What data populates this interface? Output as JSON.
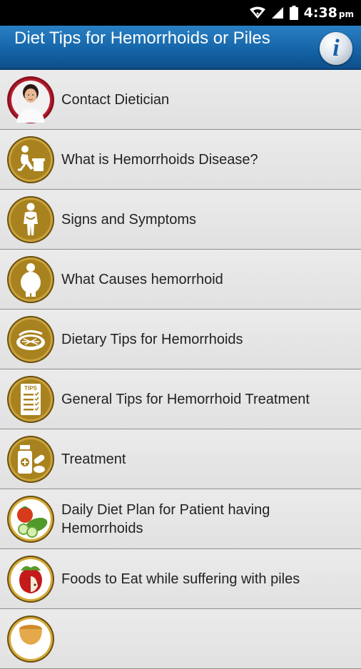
{
  "status_bar": {
    "time": "4:38",
    "ampm": "pm"
  },
  "app_bar": {
    "title": "Diet Tips for Hemorrhoids or Piles"
  },
  "menu": {
    "items": [
      {
        "label": "Contact Dietician",
        "icon": "dietician-avatar-icon"
      },
      {
        "label": "What is Hemorrhoids Disease?",
        "icon": "person-sitting-icon"
      },
      {
        "label": "Signs and Symptoms",
        "icon": "person-symptom-icon"
      },
      {
        "label": "What Causes hemorrhoid",
        "icon": "overweight-person-icon"
      },
      {
        "label": "Dietary Tips for Hemorrhoids",
        "icon": "food-plate-icon"
      },
      {
        "label": "General Tips for Hemorrhoid Treatment",
        "icon": "tips-checklist-icon"
      },
      {
        "label": "Treatment",
        "icon": "medicine-bottle-icon"
      },
      {
        "label": "Daily Diet Plan for Patient having Hemorrhoids",
        "icon": "vegetables-icon"
      },
      {
        "label": "Foods to Eat while suffering with piles",
        "icon": "apple-icon"
      },
      {
        "label": "",
        "icon": "tea-cup-icon"
      }
    ]
  },
  "icons": {
    "tips_text": "TIPS"
  },
  "colors": {
    "app_bar": "#1565a8",
    "gold": "#b8902a",
    "status_bar": "#000000"
  }
}
